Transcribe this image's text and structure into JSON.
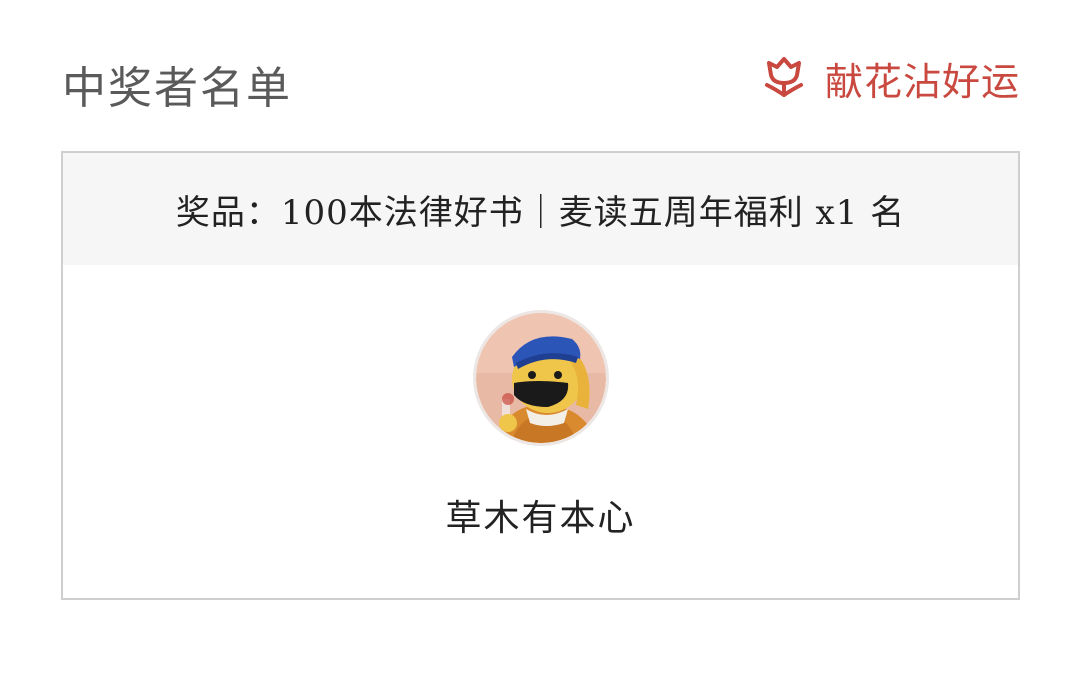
{
  "header": {
    "title": "中奖者名单",
    "flower_link_label": "献花沾好运",
    "flower_icon": "flower-icon",
    "accent_color": "#c9483f"
  },
  "prize": {
    "text": "奖品：100本法律好书｜麦读五周年福利 x1 名"
  },
  "winner": {
    "avatar_icon": "avatar-illustration",
    "name": "草木有本心"
  }
}
